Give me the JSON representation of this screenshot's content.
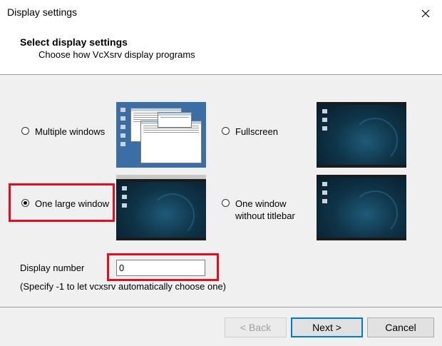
{
  "window": {
    "title": "Display settings"
  },
  "header": {
    "title": "Select display settings",
    "subtitle": "Choose how VcXsrv display programs"
  },
  "options": [
    {
      "label": "Multiple windows",
      "selected": false
    },
    {
      "label": "Fullscreen",
      "selected": false
    },
    {
      "label": "One large window",
      "selected": true
    },
    {
      "label_line1": "One window",
      "label_line2": "without titlebar",
      "selected": false
    }
  ],
  "display_number": {
    "label": "Display number",
    "value": "0",
    "hint": "(Specify -1 to let vcxsrv automatically choose one)"
  },
  "buttons": {
    "back": "< Back",
    "next": "Next >",
    "cancel": "Cancel"
  },
  "colors": {
    "highlight": "#e01020",
    "default_button_border": "#0078d7"
  },
  "icons": {
    "close": "close-icon"
  }
}
